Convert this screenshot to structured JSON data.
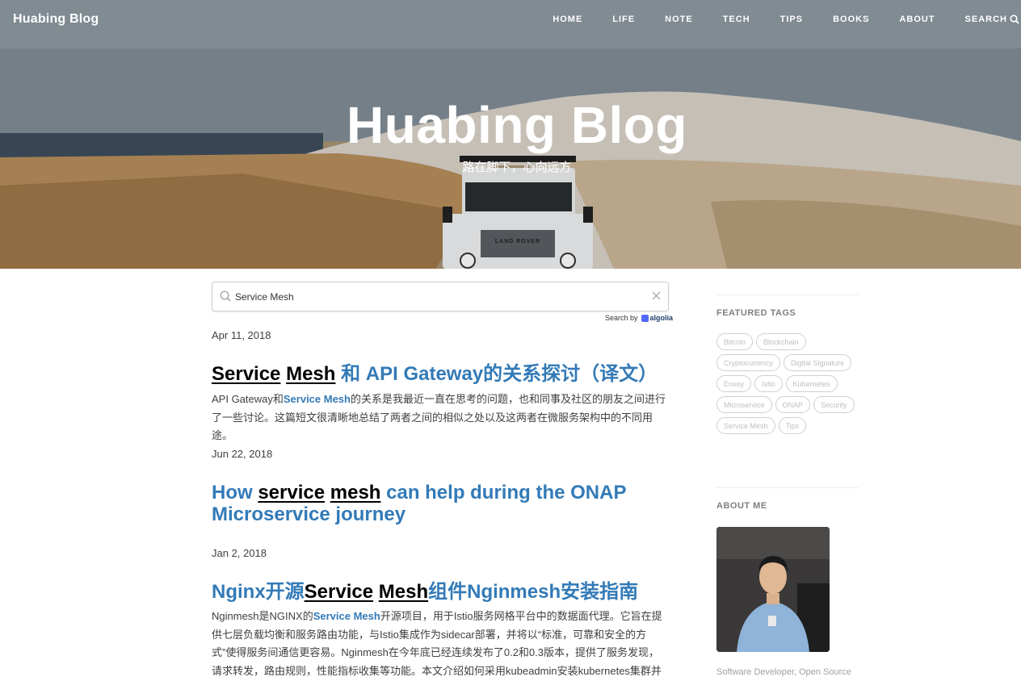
{
  "header": {
    "brand": "Huabing Blog",
    "nav": [
      "HOME",
      "LIFE",
      "NOTE",
      "TECH",
      "TIPS",
      "BOOKS",
      "ABOUT",
      "SEARCH"
    ],
    "search_icon": "search-icon"
  },
  "hero": {
    "title": "Huabing Blog",
    "subtitle": "路在脚下，心向远方",
    "vehicle_badge": "LAND ROVER"
  },
  "search": {
    "value": "Service Mesh",
    "search_by": "Search by",
    "provider": "algolia",
    "icon": "search-icon",
    "clear_icon": "close-icon"
  },
  "posts": [
    {
      "date": "Apr 11, 2018",
      "title_parts": [
        "Service",
        " ",
        "Mesh",
        " 和 API Gateway的关系探讨（译文）"
      ],
      "excerpt_parts": [
        "API Gateway和",
        "Service Mesh",
        "的关系是我最近一直在思考的问题，也和同事及社区的朋友之间进行了一些讨论。这篇短文很清晰地总结了两者之间的相似之处以及这两者在微服务架构中的不同用途。"
      ]
    },
    {
      "date": "Jun 22, 2018",
      "title_parts": [
        "How ",
        "service",
        " ",
        "mesh",
        " can help during the ONAP Microservice journey"
      ]
    },
    {
      "date": "Jan 2, 2018",
      "title_parts": [
        "Nginx开源",
        "Service",
        " ",
        "Mesh",
        "组件Nginmesh安装指南"
      ],
      "excerpt_parts": [
        "Nginmesh是NGINX的",
        "Service Mesh",
        "开源项目，用于Istio服务网格平台中的数据面代理。它旨在提供七层负载均衡和服务路由功能，与Istio集成作为sidecar部署，并将以“标准，可靠和安全的方式”使得服务间通信更容易。Nginmesh在今年底已经连续发布了0.2和0.3版本，提供了服务发现，请求转发，路由规则，性能指标收集等功能。本文介绍如何采用kubeadmin安装kubernetes集群并部署"
      ]
    }
  ],
  "sidebar": {
    "featured_tags_title": "FEATURED TAGS",
    "tags": [
      "Bitcoin",
      "Blockchain",
      "Cryptocurrency",
      "Digital Signature",
      "Envoy",
      "Istio",
      "Kubernetes",
      "Microservice",
      "ONAP",
      "Security",
      "Service Mesh",
      "Tips"
    ],
    "about_title": "ABOUT ME",
    "about_text": "Software Developer, Open Source"
  }
}
